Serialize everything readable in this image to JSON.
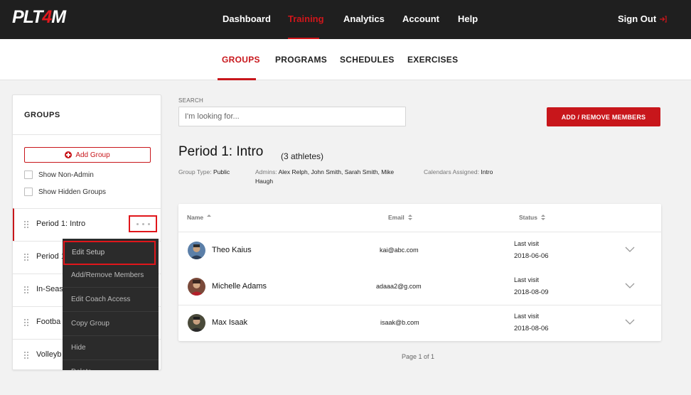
{
  "header": {
    "logo_left": "PLT",
    "logo_four": "4",
    "logo_right": "M",
    "nav": [
      {
        "label": "Dashboard",
        "active": false
      },
      {
        "label": "Training",
        "active": true
      },
      {
        "label": "Analytics",
        "active": false
      },
      {
        "label": "Account",
        "active": false
      },
      {
        "label": "Help",
        "active": false
      }
    ],
    "signout_label": "Sign Out"
  },
  "subnav": [
    {
      "label": "GROUPS",
      "active": true
    },
    {
      "label": "PROGRAMS",
      "active": false
    },
    {
      "label": "SCHEDULES",
      "active": false
    },
    {
      "label": "EXERCISES",
      "active": false
    }
  ],
  "sidebar": {
    "title": "GROUPS",
    "add_group_label": "Add Group",
    "show_non_admin_label": "Show Non-Admin",
    "show_hidden_label": "Show Hidden Groups",
    "groups": [
      {
        "name": "Period 1: Intro"
      },
      {
        "name": "Period 1"
      },
      {
        "name": "In-Seas"
      },
      {
        "name": "Footba"
      },
      {
        "name": "Volleyb"
      }
    ]
  },
  "context_menu": {
    "items": [
      "Edit Setup",
      "Add/Remove Members",
      "Edit Coach Access",
      "Copy Group",
      "Hide",
      "Delete"
    ]
  },
  "main": {
    "search_label": "SEARCH",
    "search_placeholder": "I'm looking for...",
    "add_remove_button": "ADD / REMOVE MEMBERS",
    "group_title": "Period 1: Intro",
    "athlete_count": "(3 athletes)",
    "group_type_key": "Group Type:",
    "group_type_value": "Public",
    "admins_key": "Admins:",
    "admins_value_line1": "Alex Relph, John Smith, Sarah Smith, Mike",
    "admins_value_line2": "Haugh",
    "calendars_key": "Calendars Assigned:",
    "calendars_value": "Intro"
  },
  "table": {
    "headers": {
      "name": "Name",
      "email": "Email",
      "status": "Status"
    },
    "rows": [
      {
        "name": "Theo Kaius",
        "email": "kai@abc.com",
        "status_label": "Last visit",
        "status_date": "2018-06-06"
      },
      {
        "name": "Michelle Adams",
        "email": "adaaa2@g.com",
        "status_label": "Last visit",
        "status_date": "2018-08-09"
      },
      {
        "name": "Max Isaak",
        "email": "isaak@b.com",
        "status_label": "Last visit",
        "status_date": "2018-08-06"
      }
    ],
    "pager": "Page 1 of 1"
  },
  "colors": {
    "brand_red": "#c8161b",
    "topbar": "#1f1f1f",
    "menu_bg": "#2b2b2b"
  }
}
